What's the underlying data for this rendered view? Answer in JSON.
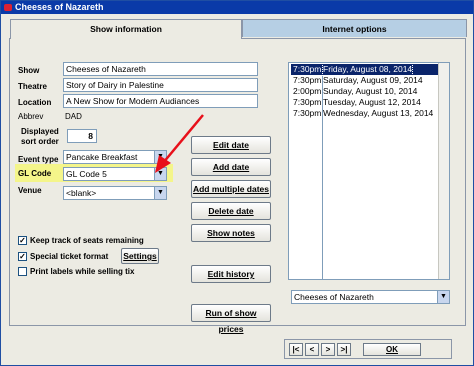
{
  "window": {
    "title": "Cheeses of Nazareth"
  },
  "tabs": [
    {
      "label": "Show information"
    },
    {
      "label": "Internet options"
    }
  ],
  "form": {
    "show_label": "Show",
    "show_value": "Cheeses of Nazareth",
    "theatre_label": "Theatre",
    "theatre_value": "Story of Dairy in Palestine",
    "location_label": "Location",
    "location_value": "A New Show for Modern Audiances",
    "abbrev_label": "Abbrev",
    "abbrev_value": "DAD",
    "sort_label_1": "Displayed",
    "sort_label_2": "sort order",
    "sort_value": "8",
    "event_label": "Event type",
    "event_value": "Pancake Breakfast",
    "glcode_label": "GL Code",
    "glcode_value": "GL Code 5",
    "venue_label": "Venue",
    "venue_value": "<blank>"
  },
  "buttons": {
    "edit_date": "Edit date",
    "add_date": "Add date",
    "add_multiple": "Add multiple dates",
    "delete_date": "Delete date",
    "show_notes": "Show notes",
    "edit_history": "Edit history",
    "run_prices": "Run of show prices",
    "settings": "Settings",
    "ok": "OK"
  },
  "checkboxes": [
    {
      "label": "Keep track of seats remaining",
      "checked": true
    },
    {
      "label": "Special ticket format",
      "checked": true
    },
    {
      "label": "Print labels while selling tix",
      "checked": false
    }
  ],
  "dates": [
    {
      "time": "7:30pm",
      "date": "Friday, August 08, 2014",
      "selected": true
    },
    {
      "time": "7:30pm",
      "date": "Saturday, August 09, 2014"
    },
    {
      "time": "2:00pm",
      "date": "Sunday, August 10, 2014"
    },
    {
      "time": "7:30pm",
      "date": "Tuesday, August 12, 2014"
    },
    {
      "time": "7:30pm",
      "date": "Wednesday, August 13, 2014"
    }
  ],
  "show_select_value": "Cheeses of Nazareth",
  "nav": {
    "first": "|<",
    "prev": "<",
    "next": ">",
    "last": ">|"
  },
  "colors": {
    "highlight": "#f4f58a",
    "arrow": "#e8101a",
    "titlebar": "#0a3aa8"
  }
}
